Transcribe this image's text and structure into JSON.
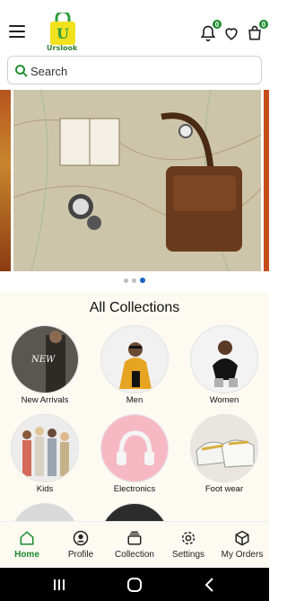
{
  "header": {
    "logo_text": "Urslook",
    "notification_badge": "0",
    "cart_badge": "0"
  },
  "search": {
    "placeholder": "Search"
  },
  "banner": {
    "page_count": 3,
    "active_page": 3
  },
  "collections": {
    "title": "All Collections",
    "items": [
      {
        "label": "New Arrivals"
      },
      {
        "label": "Men"
      },
      {
        "label": "Women"
      },
      {
        "label": "Kids"
      },
      {
        "label": "Electronics"
      },
      {
        "label": "Foot wear"
      }
    ]
  },
  "bottom_nav": {
    "items": [
      {
        "label": "Home",
        "icon": "home-icon",
        "active": true
      },
      {
        "label": "Profile",
        "icon": "profile-icon"
      },
      {
        "label": "Collection",
        "icon": "collection-icon"
      },
      {
        "label": "Settings",
        "icon": "settings-icon"
      },
      {
        "label": "My Orders",
        "icon": "orders-icon"
      }
    ]
  },
  "colors": {
    "accent": "#1b8a2e",
    "section_bg": "#fdfaf2",
    "dot_active": "#1565c0"
  }
}
